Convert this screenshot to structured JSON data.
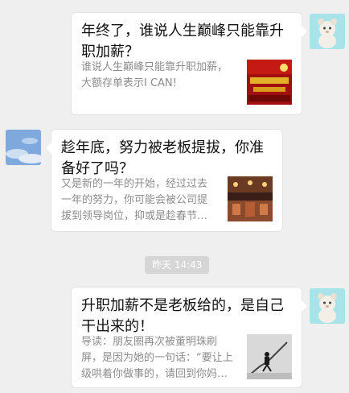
{
  "messages": [
    {
      "title": "年终了，谁说人生巅峰只能靠升\n职加薪？",
      "description": "谁说人生巅峰只能靠升职加薪，\n大额存单表示I CAN!",
      "thumbnail_icon": "red-gold-banner-image"
    },
    {
      "title": "趁年底，努力被老板提拔，你准\n备好了吗？",
      "description": "又是新的一年的开始，经过过去\n一年的努力，你可能会被公司提\n拔到领导岗位，抑或是趁春节…",
      "thumbnail_icon": "party-hall-image"
    },
    {
      "title": "升职加薪不是老板给的，是自己\n干出来的！",
      "description": "导读：朋友圈再次被董明珠刷\n屏，是因为她的一句话：“要让上\n级哄着你做事的，请回到你妈…",
      "thumbnail_icon": "rising-stairs-image"
    }
  ],
  "timestamp": "昨天 14:43",
  "colors": {
    "background": "#efefef",
    "bubble": "#ffffff",
    "title_text": "#111111",
    "desc_text": "#8c8c8c",
    "time_pill": "#d6d6d6"
  }
}
